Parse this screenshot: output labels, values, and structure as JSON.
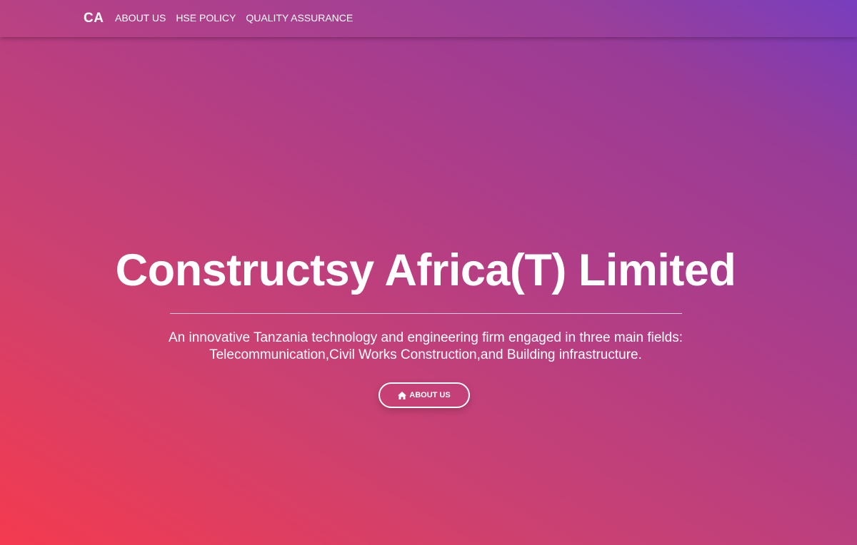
{
  "nav": {
    "brand": "CA",
    "links": [
      {
        "label": "ABOUT US"
      },
      {
        "label": "HSE POLICY"
      },
      {
        "label": "QUALITY ASSURANCE"
      }
    ]
  },
  "hero": {
    "title": "Constructsy Africa(T) Limited",
    "subtitle_line1": "An innovative Tanzania technology and engineering firm engaged in three main fields:",
    "subtitle_line2": "Telecommunication,Civil Works Construction,and Building infrastructure.",
    "button": {
      "icon": "home-icon",
      "label": "ABOUT US"
    }
  },
  "colors": {
    "gradient_start": "#f43a4f",
    "gradient_mid": "#ad3d8a",
    "gradient_end": "#763bbd",
    "text": "#ffffff"
  }
}
